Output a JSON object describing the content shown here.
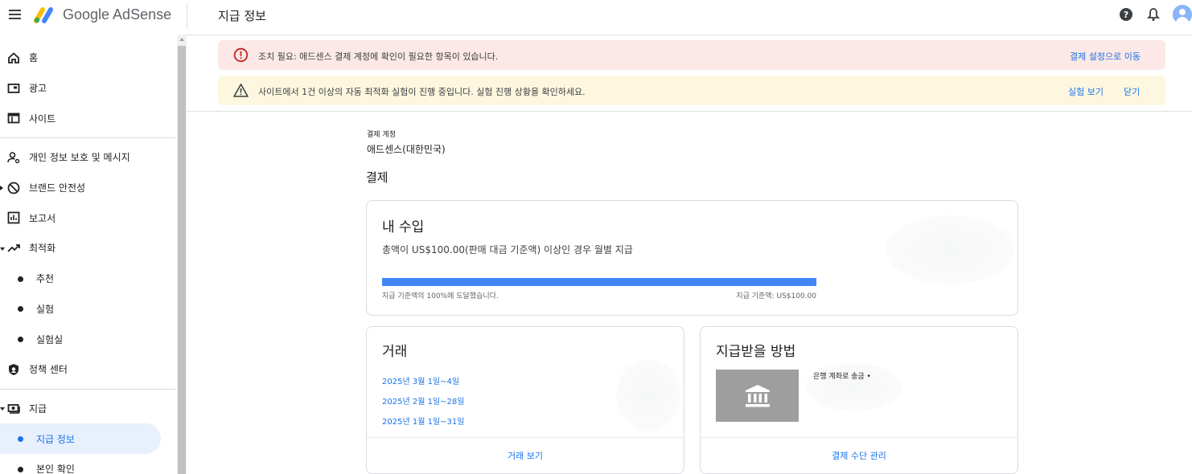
{
  "header": {
    "product_name": "Google AdSense",
    "page_title": "지급 정보"
  },
  "sidebar": {
    "items": [
      {
        "label": "홈"
      },
      {
        "label": "광고"
      },
      {
        "label": "사이트"
      },
      {
        "label": "개인 정보 보호 및 메시지"
      },
      {
        "label": "브랜드 안전성"
      },
      {
        "label": "보고서"
      },
      {
        "label": "최적화"
      },
      {
        "label": "추천"
      },
      {
        "label": "실험"
      },
      {
        "label": "실험실"
      },
      {
        "label": "정책 센터"
      },
      {
        "label": "지급"
      },
      {
        "label": "지급 정보"
      },
      {
        "label": "본인 확인"
      }
    ]
  },
  "banners": {
    "error": {
      "text": "조치 필요: 애드센스 결제 계정에 확인이 필요한 항목이 있습니다.",
      "action": "결제 설정으로 이동"
    },
    "warning": {
      "text": "사이트에서 1건 이상의 자동 최적화 실험이 진행 중입니다. 실험 진행 상황을 확인하세요.",
      "action": "실험 보기",
      "dismiss": "닫기"
    }
  },
  "account": {
    "label": "결제 계정",
    "value": "애드센스(대한민국)"
  },
  "section_title": "결제",
  "earnings": {
    "title": "내 수입",
    "subtitle": "총액이 US$100.00(판매 대금 기준액) 이상인 경우 월별 지급",
    "progress_percent": 100,
    "progress_left": "지급 기준액의 100%에 도달했습니다.",
    "progress_right": "지급 기준액: US$100.00"
  },
  "transactions": {
    "title": "거래",
    "links": [
      "2025년 3월 1일~4일",
      "2025년 2월 1일~28일",
      "2025년 1월 1일~31일"
    ],
    "footer": "거래 보기"
  },
  "payment_method": {
    "title": "지급받을 방법",
    "bank_text": "은행 계좌로 송금 •",
    "footer": "결제 수단 관리"
  },
  "colors": {
    "accent": "#1a73e8",
    "progress": "#4285f4",
    "error_bg": "#fce8e6",
    "warn_bg": "#fef7e0"
  }
}
